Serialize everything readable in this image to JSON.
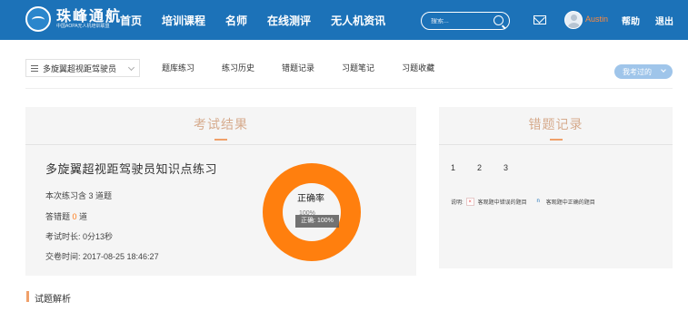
{
  "header": {
    "logo_title": "珠峰通航",
    "logo_subtitle": "中国AOPA无人机培训联盟",
    "nav": [
      "首页",
      "培训课程",
      "名师",
      "在线测评",
      "无人机资讯"
    ],
    "search_placeholder": "搜索...",
    "username": "Austin",
    "help": "帮助",
    "logout": "退出",
    "colors": {
      "bar": "#1c72b8",
      "username": "#ff8a3d"
    }
  },
  "subnav": {
    "course": "多旋翼超视距驾驶员",
    "items": [
      "题库练习",
      "练习历史",
      "错题记录",
      "习题笔记",
      "习题收藏"
    ],
    "history_button": "我考过的"
  },
  "result": {
    "title": "考试结果",
    "exam_name": "多旋翼超视距驾驶员知识点练习",
    "stat_questions": "本次练习含 3 道题",
    "wrong_prefix": "答错题 ",
    "wrong_count": "0",
    "wrong_suffix": " 道",
    "stat_duration": "考试时长:  0分13秒",
    "stat_submit": "交卷时间:  2017-08-25 18:46:27",
    "chart_label": "正确率",
    "ghost_value": "100%",
    "tooltip": "正确: 100%"
  },
  "chart_data": {
    "type": "pie",
    "title": "正确率",
    "categories": [
      "正确"
    ],
    "values": [
      100
    ],
    "colors": [
      "#ff7f0e"
    ]
  },
  "wrong_panel": {
    "title": "错题记录",
    "question_numbers": [
      "1",
      "2",
      "3"
    ],
    "legend_prefix": "说明:",
    "legend_wrong_mark": "×",
    "legend_wrong": "客观题中错误的题目",
    "legend_right_mark": "n",
    "legend_right": "客观题中正确的题目"
  },
  "section": {
    "title": "试题解析"
  }
}
